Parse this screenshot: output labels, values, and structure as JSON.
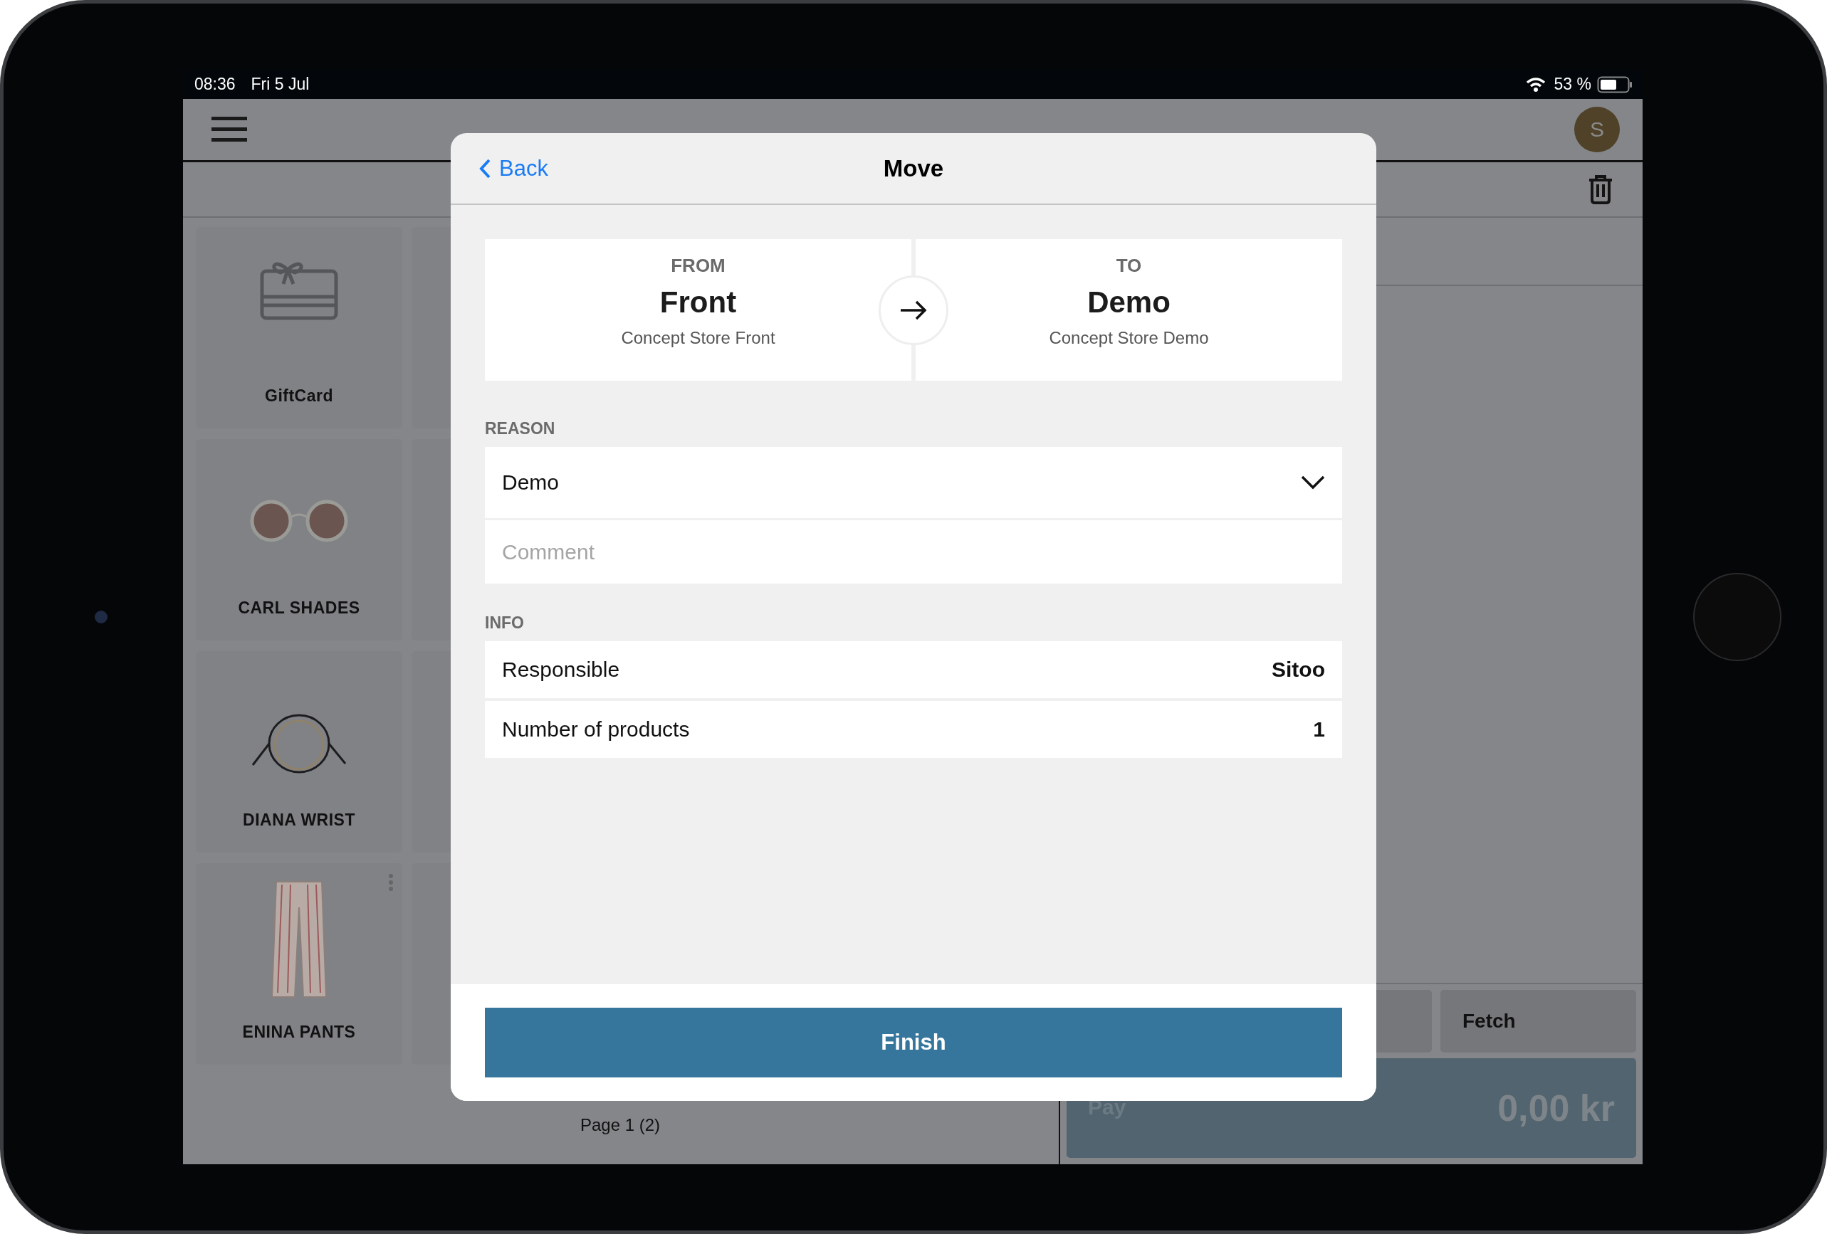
{
  "status_bar": {
    "time": "08:36",
    "date": "Fri 5 Jul",
    "battery": "53 %"
  },
  "header": {
    "avatar_initial": "S"
  },
  "products": [
    {
      "name": "GiftCard",
      "kind": "giftcard",
      "has_menu": false
    },
    {
      "name": "CARL SHADES",
      "kind": "sunglasses",
      "has_menu": false
    },
    {
      "name": "DIANA WRIST",
      "kind": "bracelet",
      "has_menu": false
    },
    {
      "name": "ENINA PANTS",
      "kind": "pants",
      "has_menu": true
    }
  ],
  "pager": "Page 1 (2)",
  "cart": {
    "fetch": "Fetch",
    "pay_label": "Pay",
    "total": "0,00 kr"
  },
  "modal": {
    "back": "Back",
    "title": "Move",
    "from": {
      "label": "FROM",
      "name": "Front",
      "store": "Concept Store Front"
    },
    "to": {
      "label": "TO",
      "name": "Demo",
      "store": "Concept Store Demo"
    },
    "reason_label": "REASON",
    "reason": "Demo",
    "comment_placeholder": "Comment",
    "info_label": "INFO",
    "info": [
      {
        "label": "Responsible",
        "value": "Sitoo"
      },
      {
        "label": "Number of products",
        "value": "1"
      }
    ],
    "finish": "Finish"
  }
}
